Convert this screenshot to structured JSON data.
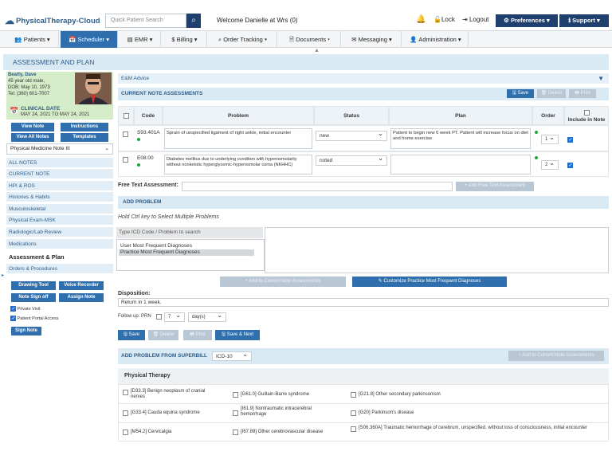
{
  "app": {
    "logo": "PhysicalTherapy-Cloud",
    "search_placeholder": "Quick Patient Search",
    "welcome": "Welcome Danielle at Wrs (0)",
    "lock": "Lock",
    "logout": "Logout",
    "preferences": "Preferences",
    "support": "Support"
  },
  "nav": [
    "Patients",
    "Scheduler",
    "EMR",
    "Billing",
    "Order Tracking",
    "Documents",
    "Messaging",
    "Administration"
  ],
  "page_title": "ASSESSMENT AND PLAN",
  "patient": {
    "name": "Beatty, Dave",
    "age": "45 year old male,",
    "dob": "DOB: May 10, 1973",
    "tel": "Tel: (360) 601-7007",
    "clinical_label": "CLINICAL DATE",
    "clinical_range": "MAY 24, 2021 TO MAY 24, 2021"
  },
  "left_buttons": {
    "view_note": "View Note",
    "instructions": "Instructions",
    "view_all_notes": "View All Notes",
    "templates": "Templates"
  },
  "note_select": "Physical Medicine Note III",
  "left_nav": [
    "ALL NOTES",
    "CURRENT NOTE",
    "HPI & ROS",
    "Histories & Habits",
    "Musculoskeletal",
    "Physical Exam-MSK",
    "Radiologic/Lab Review",
    "Medications",
    "Assessment & Plan",
    "Orders & Procedures"
  ],
  "tools": {
    "drawing_tool": "Drawing Tool",
    "voice_recorder": "Voice Recorder",
    "note_sign_off": "Note Sign off",
    "assign_note": "Assign Note",
    "private_visit": "Private Visit",
    "patient_portal_access": "Patient Portal Access",
    "sign_note": "Sign Note"
  },
  "em_advice": "E&M Advice",
  "current_assessments": {
    "title": "CURRENT NOTE ASSESSMENTS",
    "save": "Save",
    "delete": "Delete",
    "print": "Print",
    "headers": {
      "code": "Code",
      "problem": "Problem",
      "status": "Status",
      "plan": "Plan",
      "order": "Order",
      "include": "Include in Note"
    },
    "rows": [
      {
        "code": "S93.401A",
        "problem": "Sprain of unspecified ligament of right ankle, initial encounter",
        "status": "new",
        "plan": "Patient to begin new 6 week PT.  Patient will increase focus on diet and home exercise",
        "order": "1"
      },
      {
        "code": "E08.00",
        "problem": "Diabetes mellitus due to underlying condition with hyperosmolarity without nonketotic hyperglycemic-hyperosmolar coma (NKHHC)",
        "status": "noted",
        "plan": "",
        "order": "2"
      }
    ]
  },
  "free_text": {
    "label": "Free Text Assessment:",
    "add_button": "Add Free Text Assessment"
  },
  "add_problem": {
    "title": "ADD PROBLEM",
    "hint": "Hold Ctrl key to Select Multiple Problems",
    "icd_placeholder": "Type ICD Code / Problem to search",
    "list": [
      "User Most Frequent Diagnoses",
      "Practice Most Frequent Diagnoses"
    ],
    "add_current": "Add to Current Note Assessments",
    "customize": "Customize Practice Most Frequent Diagnoses"
  },
  "disposition": {
    "label": "Disposition:",
    "value": "Return in 1 week."
  },
  "follow_up": {
    "label": "Follow up:",
    "prn": "PRN",
    "number": "7",
    "unit": "day(s)"
  },
  "bottom_buttons": {
    "save": "Save",
    "delete": "Delete",
    "print": "Print",
    "save_next": "Save & Next"
  },
  "superbill": {
    "title": "ADD PROBLEM FROM SUPERBILL",
    "code_set": "ICD-10",
    "add_button": "Add to Current Note Assessments",
    "section": "Physical Therapy",
    "items": [
      "[D33.3] Benign neoplasm of cranial nerves",
      "[G61.0] Guillain-Barre syndrome",
      "[G21.8] Other secondary parkinsonism",
      "[G33.4] Cauda equina syndrome",
      "[I61.9] Nontraumatic intracerebral hemorrhage",
      "[G20] Parkinson's disease",
      "[M54.2] Cervicalgia",
      "[I67.89] Other cerebrovascular disease",
      "[S06.360A] Traumatic hemorrhage of cerebrum, unspecified, without loss of consciousness, initial encounter"
    ]
  }
}
